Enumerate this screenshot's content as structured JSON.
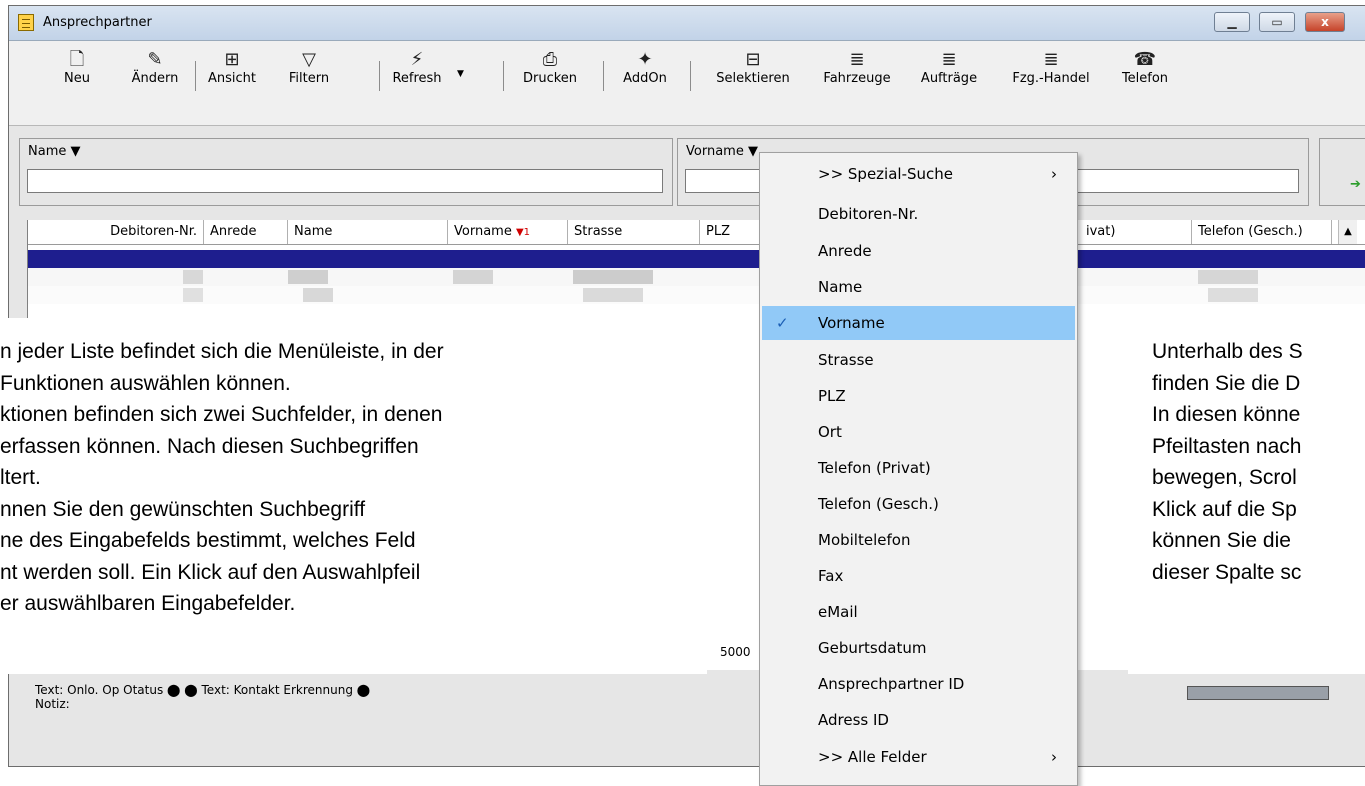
{
  "window": {
    "title": "Ansprechpartner",
    "buttons": {
      "minimize": "▁",
      "maximize": "▭",
      "close": "x"
    }
  },
  "toolbar": {
    "items": [
      {
        "label": "Neu",
        "icon": "new-document-icon",
        "glyph": "🗋"
      },
      {
        "label": "Ändern",
        "icon": "edit-icon",
        "glyph": "✎"
      },
      {
        "label": "Ansicht",
        "icon": "view-icon",
        "glyph": "⊞"
      },
      {
        "label": "Filtern",
        "icon": "filter-icon",
        "glyph": "▽"
      },
      {
        "label": "Refresh",
        "icon": "refresh-icon",
        "glyph": "⚡"
      },
      {
        "label": "Drucken",
        "icon": "print-icon",
        "glyph": "⎙"
      },
      {
        "label": "AddOn",
        "icon": "addon-icon",
        "glyph": "✦"
      },
      {
        "label": "Selektieren",
        "icon": "select-icon",
        "glyph": "⊟"
      },
      {
        "label": "Fahrzeuge",
        "icon": "list-icon",
        "glyph": "≣"
      },
      {
        "label": "Aufträge",
        "icon": "list-icon",
        "glyph": "≣"
      },
      {
        "label": "Fzg.-Handel",
        "icon": "list-icon",
        "glyph": "≣"
      },
      {
        "label": "Telefon",
        "icon": "phone-icon",
        "glyph": "☎"
      }
    ]
  },
  "search": {
    "field1_label": "Name ▼",
    "field1_value": "",
    "field2_label": "Vorname ▼",
    "field2_value": "",
    "go_arrow": "➔"
  },
  "grid": {
    "columns": [
      "Debitoren-Nr.",
      "Anrede",
      "Name",
      "Vorname",
      "Strasse",
      "PLZ",
      "ivat)",
      "Telefon (Gesch.)"
    ],
    "sort_marker": "▼1",
    "partial_value": "5000",
    "notiz_label": "Notiz:",
    "status_text": "Text: Onlo. Op Otatus ⬤ ⬤ Text: Kontakt Erkrennung ⬤"
  },
  "overlay_left": {
    "lines": [
      "n jeder Liste befindet sich die Menüleiste, in der",
      " Funktionen auswählen können.",
      "ktionen befinden sich zwei Suchfelder, in denen",
      "erfassen können. Nach diesen Suchbegriffen",
      "ltert.",
      "nnen Sie den gewünschten Suchbegriff",
      "ne des Eingabefelds bestimmt, welches Feld",
      "nt werden soll. Ein Klick auf den Auswahlpfeil",
      "er auswählbaren Eingabefelder."
    ]
  },
  "overlay_right": {
    "lines": [
      "Unterhalb des S",
      "finden Sie die D",
      "In diesen könne",
      "Pfeiltasten nach",
      "bewegen, Scrol",
      "Klick auf die Sp",
      "können Sie die",
      "dieser Spalte sc"
    ]
  },
  "menu": {
    "items": [
      {
        "label": ">> Spezial-Suche",
        "submenu": "›",
        "checked": false
      },
      {
        "label": "Debitoren-Nr.",
        "submenu": "",
        "checked": false
      },
      {
        "label": "Anrede",
        "submenu": "",
        "checked": false
      },
      {
        "label": "Name",
        "submenu": "",
        "checked": false
      },
      {
        "label": "Vorname",
        "submenu": "",
        "checked": true
      },
      {
        "label": "Strasse",
        "submenu": "",
        "checked": false
      },
      {
        "label": "PLZ",
        "submenu": "",
        "checked": false
      },
      {
        "label": "Ort",
        "submenu": "",
        "checked": false
      },
      {
        "label": "Telefon (Privat)",
        "submenu": "",
        "checked": false
      },
      {
        "label": "Telefon (Gesch.)",
        "submenu": "",
        "checked": false
      },
      {
        "label": "Mobiltelefon",
        "submenu": "",
        "checked": false
      },
      {
        "label": "Fax",
        "submenu": "",
        "checked": false
      },
      {
        "label": "eMail",
        "submenu": "",
        "checked": false
      },
      {
        "label": "Geburtsdatum",
        "submenu": "",
        "checked": false
      },
      {
        "label": "Ansprechpartner ID",
        "submenu": "",
        "checked": false
      },
      {
        "label": "Adress ID",
        "submenu": "",
        "checked": false
      },
      {
        "label": ">> Alle Felder",
        "submenu": "›",
        "checked": false
      }
    ],
    "check_glyph": "✓"
  }
}
